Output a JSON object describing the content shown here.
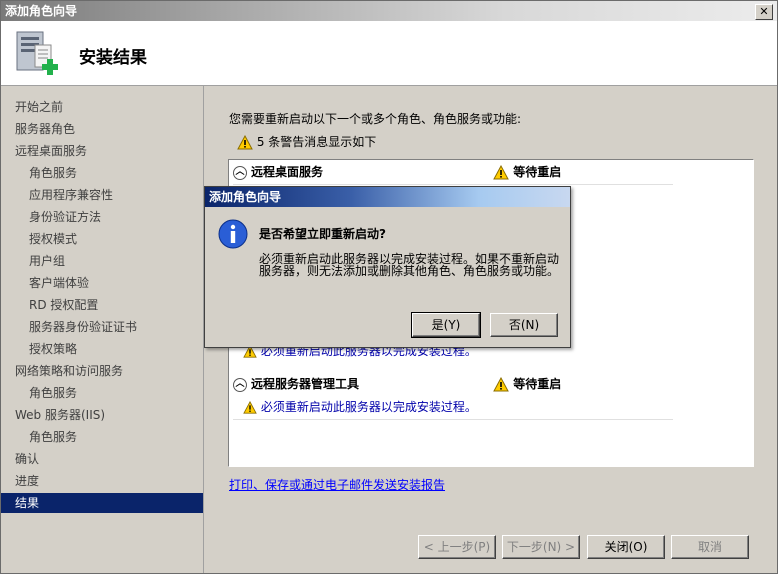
{
  "window": {
    "title": "添加角色向导",
    "close_glyph": "✕"
  },
  "header": {
    "title": "安装结果",
    "icon": "server-add-icon"
  },
  "sidebar": {
    "items": [
      {
        "label": "开始之前",
        "sub": false,
        "active": false
      },
      {
        "label": "服务器角色",
        "sub": false,
        "active": false
      },
      {
        "label": "远程桌面服务",
        "sub": false,
        "active": false
      },
      {
        "label": "角色服务",
        "sub": true,
        "active": false
      },
      {
        "label": "应用程序兼容性",
        "sub": true,
        "active": false
      },
      {
        "label": "身份验证方法",
        "sub": true,
        "active": false
      },
      {
        "label": "授权模式",
        "sub": true,
        "active": false
      },
      {
        "label": "用户组",
        "sub": true,
        "active": false
      },
      {
        "label": "客户端体验",
        "sub": true,
        "active": false
      },
      {
        "label": "RD 授权配置",
        "sub": true,
        "active": false
      },
      {
        "label": "服务器身份验证证书",
        "sub": true,
        "active": false
      },
      {
        "label": "授权策略",
        "sub": true,
        "active": false
      },
      {
        "label": "网络策略和访问服务",
        "sub": false,
        "active": false
      },
      {
        "label": "角色服务",
        "sub": true,
        "active": false
      },
      {
        "label": "Web 服务器(IIS)",
        "sub": false,
        "active": false
      },
      {
        "label": "角色服务",
        "sub": true,
        "active": false
      },
      {
        "label": "确认",
        "sub": false,
        "active": false
      },
      {
        "label": "进度",
        "sub": false,
        "active": false
      },
      {
        "label": "结果",
        "sub": false,
        "active": true
      }
    ]
  },
  "main": {
    "intro": "您需要重新启动以下一个或多个角色、角色服务或功能:",
    "warning_summary": "5 条警告消息显示如下",
    "sections": [
      {
        "name": "远程桌面服务",
        "status": "等待重启",
        "message": ""
      },
      {
        "name": "",
        "status": "",
        "message": "必须重新启动此服务器以完成安装过程。"
      },
      {
        "name": "远程服务器管理工具",
        "status": "等待重启",
        "message": "必须重新启动此服务器以完成安装过程。"
      }
    ],
    "report_link": "打印、保存或通过电子邮件发送安装报告"
  },
  "buttons": {
    "prev": "< 上一步(P)",
    "next": "下一步(N) >",
    "close": "关闭(O)",
    "cancel": "取消"
  },
  "dialog": {
    "title": "添加角色向导",
    "question": "是否希望立即重新启动?",
    "body": "必须重新启动此服务器以完成安装过程。如果不重新启动服务器，则无法添加或删除其他角色、角色服务或功能。",
    "yes": "是(Y)",
    "no": "否(N)"
  },
  "colors": {
    "selection": "#0a246a",
    "link": "#0000ff",
    "warning": "#ffcc00"
  }
}
